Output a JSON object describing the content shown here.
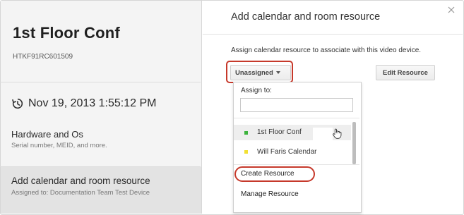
{
  "device": {
    "name": "1st Floor Conf",
    "serial": "HTKF91RC601509",
    "last_sync": "Nov 19, 2013 1:55:12 PM"
  },
  "sections": {
    "hardware": {
      "title": "Hardware and Os",
      "subtitle": "Serial number, MEID, and more."
    },
    "calendar": {
      "title": "Add calendar and room resource",
      "subtitle": "Assigned to: Documentation Team Test Device"
    }
  },
  "dialog": {
    "title": "Add calendar and room resource",
    "description": "Assign calendar resource to associate with this video device.",
    "unassigned_label": "Unassigned",
    "edit_resource_label": "Edit Resource",
    "dropdown": {
      "assign_to_label": "Assign to:",
      "search_value": "",
      "calendars": [
        {
          "label": "1st Floor Conf",
          "color": "#3cb33c"
        },
        {
          "label": "Will Faris Calendar",
          "color": "#f2e033"
        }
      ],
      "create_resource_label": "Create Resource",
      "manage_resource_label": "Manage Resource"
    }
  },
  "colors": {
    "highlight": "#c6392b",
    "selected_section": "#e3e3e3"
  },
  "icons": {
    "history": "history-icon",
    "close": "close-icon",
    "caret": "chevron-down-icon",
    "cursor": "hand-pointer-icon"
  }
}
